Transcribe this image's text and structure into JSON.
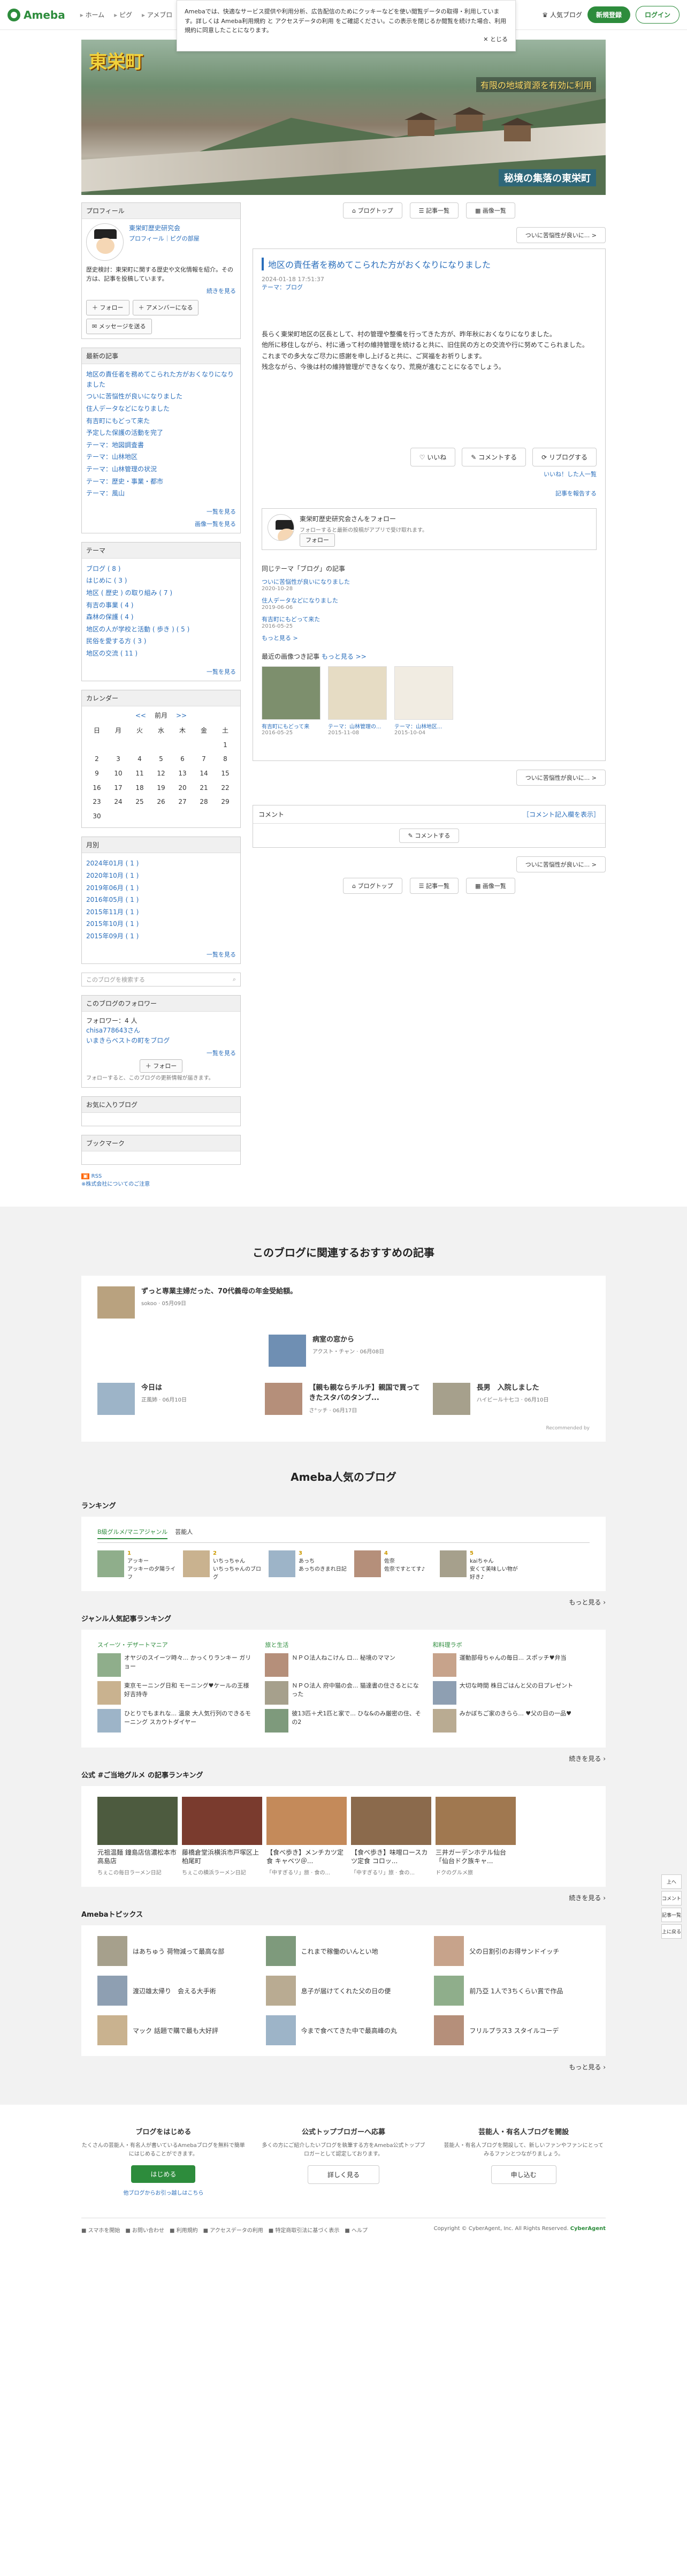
{
  "header": {
    "logo": "Ameba",
    "crumbs": [
      "ホーム",
      "ピグ",
      "アメブロ"
    ],
    "popular": "人気ブログ",
    "signup": "新規登録",
    "login": "ログイン"
  },
  "cookie": {
    "text": "Amebaでは、快適なサービス提供や利用分析、広告配信のためにクッキーなどを使い閲覧データの取得・利用しています。詳しくは Ameba利用規約 と アクセスデータの利用 をご確認ください。この表示を閉じるか閲覧を続けた場合、利用規約に同意したことになります。",
    "close": "✕ とじる"
  },
  "banner": {
    "title": "東栄町",
    "sub": "有限の地域資源を有効に利用",
    "bottom": "秘境の集落の東栄町"
  },
  "sidebar": {
    "profile_h": "プロフィール",
    "name": "東栄町歴史研究会",
    "links": "プロフィール｜ピグの部屋",
    "desc": "歴史検討：東栄町に関する歴史や文化情報を紹介。その方は、記事を投稿しています。",
    "more": "続きを見る",
    "follow": "フォロー",
    "amember": "アメンバーになる",
    "message": "メッセージを送る",
    "recent_h": "最新の記事",
    "recent": [
      "地区の責任者を務めてこられた方がおくなりになりました",
      "ついに苦悩性が良いになりました",
      "住人データなどになりました",
      "有吉町にもどって来た",
      "予定した保護の活動を完了",
      "テーマ：地図調査書",
      "テーマ：山林地区",
      "テーマ：山林管理の状況",
      "テーマ：歴史・事業・都市",
      "テーマ：風山"
    ],
    "recent_more": "一覧を見る",
    "recent_more2": "画像一覧を見る",
    "theme_h": "テーマ",
    "themes": [
      "ブログ ( 8 )",
      "はじめに ( 3 )",
      "地区 ( 歴史 ) の取り組み ( 7 )",
      "有吉の事業 ( 4 )",
      "森林の保護 ( 4 )",
      "地区の人が学校と活動 ( 歩き ) ( 5 )",
      "民俗を愛する方 ( 3 )",
      "地区の交流 ( 11 )"
    ],
    "theme_more": "一覧を見る",
    "cal_h": "カレンダー",
    "cal_nav": [
      "<<",
      "前月",
      ">>"
    ],
    "cal_days": [
      "日",
      "月",
      "火",
      "水",
      "木",
      "金",
      "土"
    ],
    "cal_rows": [
      [
        "",
        "",
        "",
        "",
        "",
        "",
        "1"
      ],
      [
        "2",
        "3",
        "4",
        "5",
        "6",
        "7",
        "8"
      ],
      [
        "9",
        "10",
        "11",
        "12",
        "13",
        "14",
        "15"
      ],
      [
        "16",
        "17",
        "18",
        "19",
        "20",
        "21",
        "22"
      ],
      [
        "23",
        "24",
        "25",
        "26",
        "27",
        "28",
        "29"
      ],
      [
        "30",
        "",
        "",
        "",
        "",
        "",
        ""
      ]
    ],
    "archive_h": "月別",
    "archive": [
      "2024年01月 ( 1 )",
      "2020年10月 ( 1 )",
      "2019年06月 ( 1 )",
      "2016年05月 ( 1 )",
      "2015年11月 ( 1 )",
      "2015年10月 ( 1 )",
      "2015年09月 ( 1 )"
    ],
    "archive_more": "一覧を見る",
    "search_ph": "このブログを検索する",
    "followers_h": "このブログのフォロワー",
    "followers_count": "フォロワー：4 人",
    "follower_names": "chisa778643さん",
    "follower_names2": "いまきらベストの町をブログ",
    "followers_more": "一覧を見る",
    "follow_btn": "フォロー",
    "follow_note": "フォローすると、このブログの更新情報が届きます。",
    "staff_h": "お気に入りブログ",
    "bookmark_h": "ブックマーク",
    "rss": "RSS",
    "rss_note": "※株式会社についてのご注意"
  },
  "main": {
    "actions": [
      "ブログトップ",
      "記事一覧",
      "画像一覧"
    ],
    "next": "ついに苦悩性が良いに... >",
    "title": "地区の責任者を務めてこられた方がおくなりになりました",
    "date": "2024-01-18 17:51:37",
    "theme": "テーマ：ブログ",
    "body": [
      "長らく東栄町地区の区長として、村の管理や整備を行ってきた方が、昨年秋におくなりになりました。",
      "他所に移住しながら、村に通って村の維持管理を続けると共に、旧住民の方との交流や行に努めてこられました。",
      "これまでの多大なご尽力に感謝を申し上げると共に、ご冥福をお祈りします。",
      "残念ながら、今後は村の維持管理ができなくなり、荒廃が進むことになるでしょう。"
    ],
    "like": "いいね",
    "comment": "コメントする",
    "reblog": "リブログする",
    "likers": "いいね！した人一覧",
    "reblog_more": "記事を報告する",
    "follow_card_name": "東栄町歴史研究会さんをフォロー",
    "follow_card_desc": "フォローすると最新の投稿がアプリで受け取れます。",
    "follow_card_btn": "フォロー",
    "same_theme_h": "同じテーマ「ブログ」の記事",
    "same_theme": [
      {
        "t": "ついに苦悩性が良いになりました",
        "d": "2020-10-28"
      },
      {
        "t": "住人データなどになりました",
        "d": "2019-06-06"
      },
      {
        "t": "有吉町にもどって来た",
        "d": "2016-05-25"
      }
    ],
    "same_more": "もっと見る >",
    "recent_img_h": "最近の画像つき記事",
    "recent_img_more": "もっと見る >>",
    "thumbs": [
      {
        "t": "有吉町にもどって来",
        "d": "2016-05-25"
      },
      {
        "t": "テーマ：山林管理の...",
        "d": "2015-11-08"
      },
      {
        "t": "テーマ：山林地区...",
        "d": "2015-10-04"
      }
    ],
    "next2": "ついに苦悩性が良いに... >",
    "comment_h": "コメント",
    "comment_help": "［コメント記入欄を表示］",
    "comment_btn": "コメントする"
  },
  "rec": {
    "title": "このブログに関連するおすすめの記事",
    "main": {
      "t": "ずっと専業主婦だった、70代義母の年金受給額。",
      "s": "sokoo · 05月09日"
    },
    "mid": {
      "t": "病室の窓から",
      "s": "アクスト・チャン · 06月08日"
    },
    "items": [
      {
        "t": "今日は",
        "s": "正風姉 · 06月10日"
      },
      {
        "t": "【親も親ならチルチ】親国で買ってきたスタバのタンブ...",
        "s": "さ°ッチ · 06月17日"
      },
      {
        "t": "長男　入院しました",
        "s": "ハイビール十七コ · 06月10日"
      }
    ],
    "footer": "Recommended by"
  },
  "popular": {
    "title": "Ameba人気のブログ",
    "ranking_h": "ランキング",
    "tabs": [
      "B級グルメ/マニアジャンル",
      "芸能人"
    ],
    "ranks": [
      {
        "n": "1",
        "t": "アッキー",
        "s": "アッキーの夕陽ライフ"
      },
      {
        "n": "2",
        "t": "いちっちゃん",
        "s": "いちっちゃんのブログ"
      },
      {
        "n": "3",
        "t": "あっち",
        "s": "あっちのきまれ日記"
      },
      {
        "n": "4",
        "t": "佐奈",
        "s": "佐奈ですとてす♪"
      },
      {
        "n": "5",
        "t": "kaiちゃん",
        "s": "安くて美味しい物が好き♪"
      }
    ],
    "more": "もっと見る",
    "genre_h": "ジャンル人気記事ランキング",
    "genres": [
      {
        "h": "スイーツ・デザートマニア",
        "items": [
          "オヤジのスイーツ時々... かっくりランキー ガリョー",
          "東京モーニング日和 モーニング♥ケールの王様 好吉持寺",
          "ひとりでもまれな... 温泉 大人気行列のできるモーニング スカウトダイヤー"
        ]
      },
      {
        "h": "旅と生活",
        "items": [
          "ＮＰＯ法人ねこけん ロ... 秘境のママン",
          "ＮＰＯ法人 府中猫の会... 猫達書の住さるとになった",
          "彼13匹＋犬1匹と家で... ひな&のみ厳密の住、その2"
        ]
      },
      {
        "h": "和料理ラボ",
        "items": [
          "運動部母ちゃんの毎日... スポッチ♥弁当",
          "大切な時間 株日ごはんと父の日プレゼント",
          "みかぼちご家のきらら... ♥父の日の一品♥"
        ]
      }
    ],
    "genre_more": "続きを見る",
    "gourmet_h": "公式 #ご当地グルメ の記事ランキング",
    "pics": [
      {
        "t": "元祖温麺 鐘島店信濃松本市高島店",
        "s": "ちぇこの毎日ラーメン日記"
      },
      {
        "t": "藤橋倉堂浜横浜市戸塚区上柏尾町",
        "s": "ちぇこの横浜ラーメン日記"
      },
      {
        "t": "【食べ歩き】メンチカツ定食 キャベツ＠...",
        "s": "「中すぎるリ」旅 · 食の..."
      },
      {
        "t": "【食べ歩き】味噌ロースカツ定食 コロッ...",
        "s": "「中すぎるリ」旅 · 食の..."
      },
      {
        "t": "三井ガーデンホテル仙台「仙台ドク族キャ...",
        "s": "ドクのグルメ旅"
      }
    ],
    "gourmet_more": "続きを見る",
    "topics_h": "Amebaトピックス",
    "topics": [
      "はあちゅう 荷物減って最高な部",
      "これまで稼働のいんとい地",
      "父の日割引のお得サンドイッチ",
      "渡辺雄太帰り　会える大手術",
      "息子が届けてくれた父の日の便",
      "前乃亞 1人で3ちくらい賞で作品",
      "マック 話題で購で最も大好評",
      "今まで食べてきた中で最高峰の丸",
      "フリルプラス3 スタイルコーデ"
    ],
    "topics_more": "もっと見る"
  },
  "cta": [
    {
      "h": "ブログをはじめる",
      "p": "たくさんの芸能人・有名人が書いているAmebaブログを無料で簡単にはじめることができます。",
      "btn": "はじめる",
      "sub": "他ブログからお引っ越しはこちら"
    },
    {
      "h": "公式トップブロガーへ応募",
      "p": "多くの方にご紹介したいブログを執筆する方をAmeba公式トップブロガーとして認定しております。",
      "btn": "詳しく見る"
    },
    {
      "h": "芸能人・有名人ブログを開設",
      "p": "芸能人・有名人ブログを開設して、新しいファンやファンにとってみるファンとつながりましょう。",
      "btn": "申し込む"
    }
  ],
  "footer": {
    "links": "■ スマホを開始　■ お問い合わせ　■ 利用規約　■ アクセスデータの利用　■ 特定商取引法に基づく表示　■ ヘルプ",
    "copy": "Copyright © CyberAgent, Inc. All Rights Reserved.",
    "brand": "CyberAgent"
  },
  "floatnav": [
    "上へ",
    "コメント",
    "記事一覧",
    "上に戻る"
  ]
}
